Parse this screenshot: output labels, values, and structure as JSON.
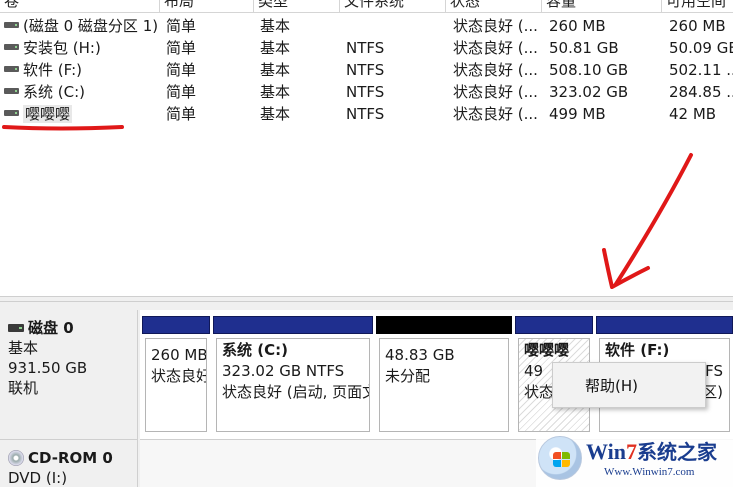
{
  "table": {
    "headers": [
      "卷",
      "布局",
      "类型",
      "文件系统",
      "状态",
      "容量",
      "可用空间"
    ],
    "rows": [
      {
        "volume": "(磁盘 0 磁盘分区 1)",
        "layout": "简单",
        "type": "基本",
        "fs": "",
        "status": "状态良好 (...",
        "capacity": "260 MB",
        "free": "260 MB"
      },
      {
        "volume": "安装包 (H:)",
        "layout": "简单",
        "type": "基本",
        "fs": "NTFS",
        "status": "状态良好 (...",
        "capacity": "50.81 GB",
        "free": "50.09 GB"
      },
      {
        "volume": "软件 (F:)",
        "layout": "简单",
        "type": "基本",
        "fs": "NTFS",
        "status": "状态良好 (...",
        "capacity": "508.10 GB",
        "free": "502.11 ..."
      },
      {
        "volume": "系统 (C:)",
        "layout": "简单",
        "type": "基本",
        "fs": "NTFS",
        "status": "状态良好 (...",
        "capacity": "323.02 GB",
        "free": "284.85 ..."
      },
      {
        "volume": "嘤嘤嘤",
        "layout": "简单",
        "type": "基本",
        "fs": "NTFS",
        "status": "状态良好 (...",
        "capacity": "499 MB",
        "free": "42 MB"
      }
    ]
  },
  "disk0": {
    "name": "磁盘 0",
    "type": "基本",
    "size": "931.50 GB",
    "state": "联机",
    "partitions": [
      {
        "name": "",
        "size": "260 MB",
        "status": "状态良好"
      },
      {
        "name": "系统 (C:)",
        "size": "323.02 GB NTFS",
        "status": "状态良好 (启动, 页面文"
      },
      {
        "name": "",
        "size": "48.83 GB",
        "status": "未分配"
      },
      {
        "name": "嘤嘤嘤",
        "size": "49",
        "status": "状态"
      },
      {
        "name": "软件 (F:)",
        "size": "TFS",
        "status": "区)"
      }
    ]
  },
  "cdrom": {
    "name": "CD-ROM 0",
    "drive": "DVD (I:)"
  },
  "context_menu": {
    "items": [
      "帮助(H)"
    ]
  },
  "watermark": {
    "title_w": "Win",
    "title_seven": "7",
    "title_rest": "系统之家",
    "url": "Www.Winwin7.com"
  },
  "colors": {
    "partition_bar": "#1f2f8f",
    "unallocated_bar": "#000000",
    "annotation": "#e01818"
  }
}
